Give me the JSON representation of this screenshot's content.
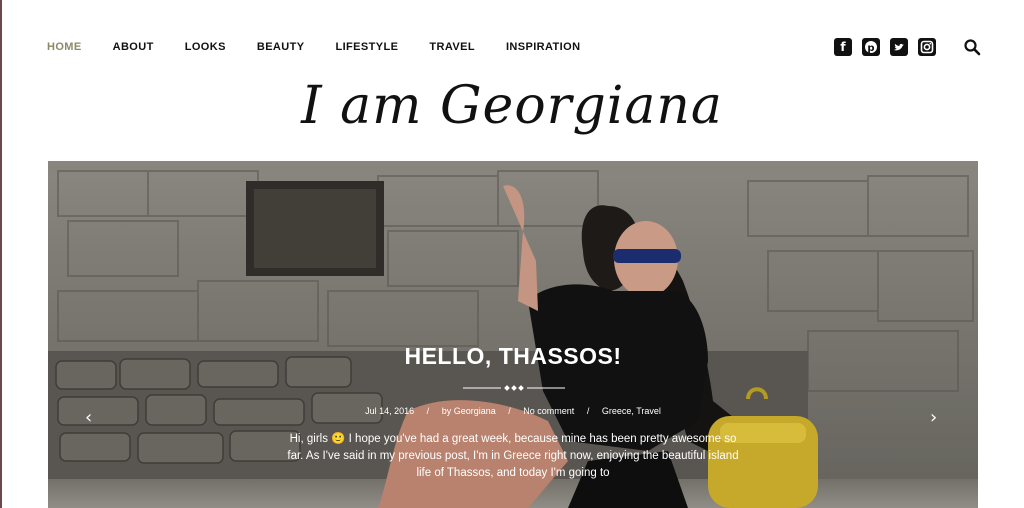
{
  "nav": {
    "items": [
      {
        "label": "HOME",
        "active": true
      },
      {
        "label": "ABOUT"
      },
      {
        "label": "LOOKS"
      },
      {
        "label": "BEAUTY"
      },
      {
        "label": "LIFESTYLE"
      },
      {
        "label": "TRAVEL"
      },
      {
        "label": "INSPIRATION"
      }
    ]
  },
  "social": {
    "icons": [
      "facebook-icon",
      "pinterest-icon",
      "twitter-icon",
      "instagram-icon"
    ],
    "search_icon": "search-icon"
  },
  "logo": {
    "text": "I am Georgiana"
  },
  "slide": {
    "title": "HELLO, THASSOS!",
    "date": "Jul 14, 2016",
    "author": "by Georgiana",
    "comments": "No comment",
    "categories": "Greece, Travel",
    "sep": "/",
    "excerpt": "Hi, girls 🙂 I hope you've had a great week, because mine has been pretty awesome so far. As I've said in my previous post, I'm in Greece right now, enjoying the beautiful island life of Thassos, and today I'm going to",
    "prev_icon": "chevron-left-icon",
    "next_icon": "chevron-right-icon"
  },
  "colors": {
    "active_nav": "#8a8a6a",
    "text": "#111111",
    "overlay_text": "#ffffff"
  }
}
